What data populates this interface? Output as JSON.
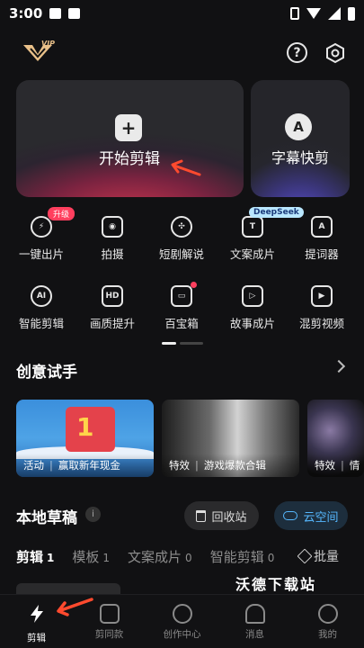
{
  "status_bar": {
    "time": "3:00"
  },
  "header": {
    "logo_badge": "VIP",
    "help_icon": "question-circle-icon",
    "settings_icon": "hexagon-settings-icon"
  },
  "main_cards": {
    "start_edit": {
      "label": "开始剪辑",
      "icon": "plus-icon",
      "gradient": "#c8344d"
    },
    "subtitle_edit": {
      "label": "字幕快剪",
      "icon_text": "A",
      "gradient": "#5b4fd6"
    }
  },
  "tools": [
    {
      "label": "一键出片",
      "icon": "lightning-icon",
      "icon_text": "⚡",
      "badge": "升级"
    },
    {
      "label": "拍摄",
      "icon": "camera-icon",
      "icon_text": "◉"
    },
    {
      "label": "短剧解说",
      "icon": "film-reel-icon",
      "icon_text": "✣"
    },
    {
      "label": "文案成片",
      "icon": "text-ai-icon",
      "icon_text": "T",
      "badge": "DeepSeek"
    },
    {
      "label": "提词器",
      "icon": "prompter-icon",
      "icon_text": "A"
    },
    {
      "label": "智能剪辑",
      "icon": "ai-circle-icon",
      "icon_text": "AI"
    },
    {
      "label": "画质提升",
      "icon": "hd-icon",
      "icon_text": "HD"
    },
    {
      "label": "百宝箱",
      "icon": "toolbox-icon",
      "icon_text": "▭",
      "dot": true
    },
    {
      "label": "故事成片",
      "icon": "story-play-icon",
      "icon_text": "▷"
    },
    {
      "label": "混剪视频",
      "icon": "clapper-icon",
      "icon_text": "▶"
    }
  ],
  "creative": {
    "title": "创意试手",
    "cards": [
      {
        "tag": "活动",
        "text": "赢取新年现金",
        "decor_text": "1"
      },
      {
        "tag": "特效",
        "text": "游戏爆款合辑"
      },
      {
        "tag": "特效",
        "text": "情"
      }
    ]
  },
  "drafts": {
    "title": "本地草稿",
    "info_icon": "i",
    "recycle_label": "回收站",
    "cloud_label": "云空间",
    "tabs": [
      {
        "label": "剪辑",
        "count": "1",
        "active": true
      },
      {
        "label": "模板",
        "count": "1"
      },
      {
        "label": "文案成片",
        "count": "0"
      },
      {
        "label": "智能剪辑",
        "count": "0"
      }
    ],
    "batch_label": "批量"
  },
  "watermark": "沃德下载站",
  "bottom_nav": [
    {
      "label": "剪辑",
      "icon": "bolt-icon",
      "active": true
    },
    {
      "label": "剪同款",
      "icon": "play-square-icon"
    },
    {
      "label": "创作中心",
      "icon": "bulb-icon"
    },
    {
      "label": "消息",
      "icon": "bell-icon"
    },
    {
      "label": "我的",
      "icon": "smile-icon"
    }
  ]
}
